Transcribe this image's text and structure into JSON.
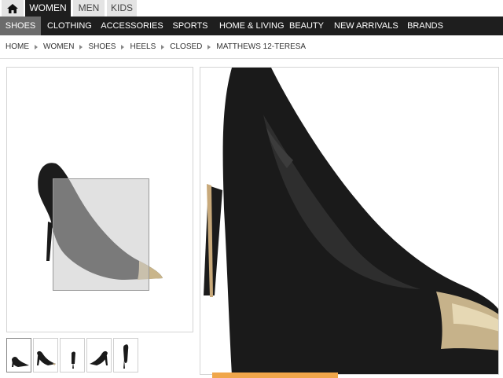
{
  "gender_tabs": [
    {
      "label": "WOMEN",
      "active": true
    },
    {
      "label": "MEN",
      "active": false
    },
    {
      "label": "KIDS",
      "active": false
    }
  ],
  "categories": [
    {
      "label": "SHOES",
      "active": true
    },
    {
      "label": "CLOTHING"
    },
    {
      "label": "ACCESSORIES"
    },
    {
      "label": "SPORTS"
    },
    {
      "label": "HOME & LIVING"
    },
    {
      "label": "BEAUTY"
    },
    {
      "label": "NEW ARRIVALS"
    },
    {
      "label": "BRANDS"
    }
  ],
  "breadcrumb": [
    "HOME",
    "WOMEN",
    "SHOES",
    "HEELS",
    "CLOSED",
    "MATTHEWS 12-TERESA"
  ],
  "colors": {
    "nav_bg": "#1e1e1e",
    "active_category_bg": "#6b6b6b",
    "tab_bg": "#e4e4e4",
    "accent_strip": "#f0a64a"
  },
  "icons": {
    "home": "home-icon",
    "breadcrumb_separator": "triangle-right-icon"
  }
}
